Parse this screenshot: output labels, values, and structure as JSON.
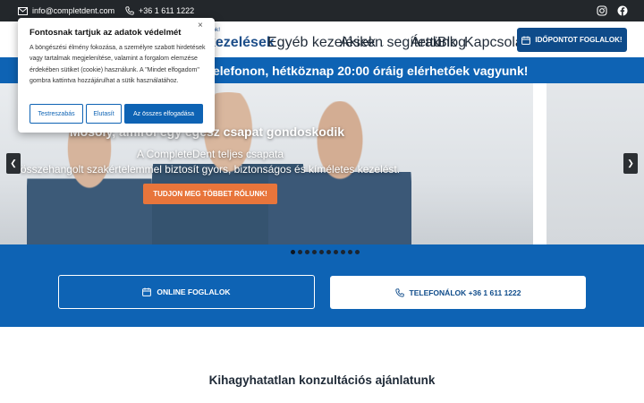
{
  "topbar": {
    "email": "info@completdent.com",
    "phone": "+36 1 611 1222",
    "social": [
      "instagram-icon",
      "facebook-icon"
    ]
  },
  "header": {
    "nav_hint": "atok!",
    "nav": [
      {
        "label": "kezelések",
        "dropdown": true,
        "active": true
      },
      {
        "label": "Egyéb kezelések",
        "dropdown": true,
        "active": false
      },
      {
        "label": "Akiken segítettünk",
        "dropdown": false,
        "active": false
      },
      {
        "label": "Árak",
        "dropdown": false,
        "active": false
      },
      {
        "label": "Blog",
        "dropdown": false,
        "active": false
      },
      {
        "label": "Kapcsolat",
        "dropdown": false,
        "active": false
      }
    ],
    "book_label": "IDŐPONTOT FOGLALOK!"
  },
  "announcement": "elefonon, hétköznap 20:00 óráig elérhetőek vagyunk!",
  "hero": {
    "title": "Mosoly, amiről egy egész csapat gondoskodik",
    "line1": "A CompleteDent teljes csapata",
    "line2": "összehangolt szakértelemmel biztosít gyors, biztonságos és kíméletes kezelést.",
    "cta": "TUDJON MEG TÖBBET RÓLUNK!",
    "slide_count": 10,
    "active_slide": 0
  },
  "actions": {
    "online_label": "ONLINE FOGLALOK",
    "phone_label": "TELEFONÁLOK +36 1 611 1222"
  },
  "section_title": "Kihagyhatatlan konzultációs ajánlatunk",
  "cookie": {
    "title": "Fontosnak tartjuk az adatok védelmét",
    "text": "A böngészési élmény fokozása, a személyre szabott hirdetések vagy tartalmak megjelenítése, valamint a forgalom elemzése érdekében sütiket (cookie) használunk. A \"Mindet elfogadom\" gombra kattintva hozzájárulhat a sütik használatához.",
    "customize": "Testreszabás",
    "reject": "Elutasít",
    "accept_all": "Az összes elfogadása",
    "close": "×"
  },
  "colors": {
    "brand_blue": "#0e63b4",
    "dark_blue": "#0e4b8a",
    "cta_orange": "#e8753b",
    "topbar": "#23272b"
  }
}
